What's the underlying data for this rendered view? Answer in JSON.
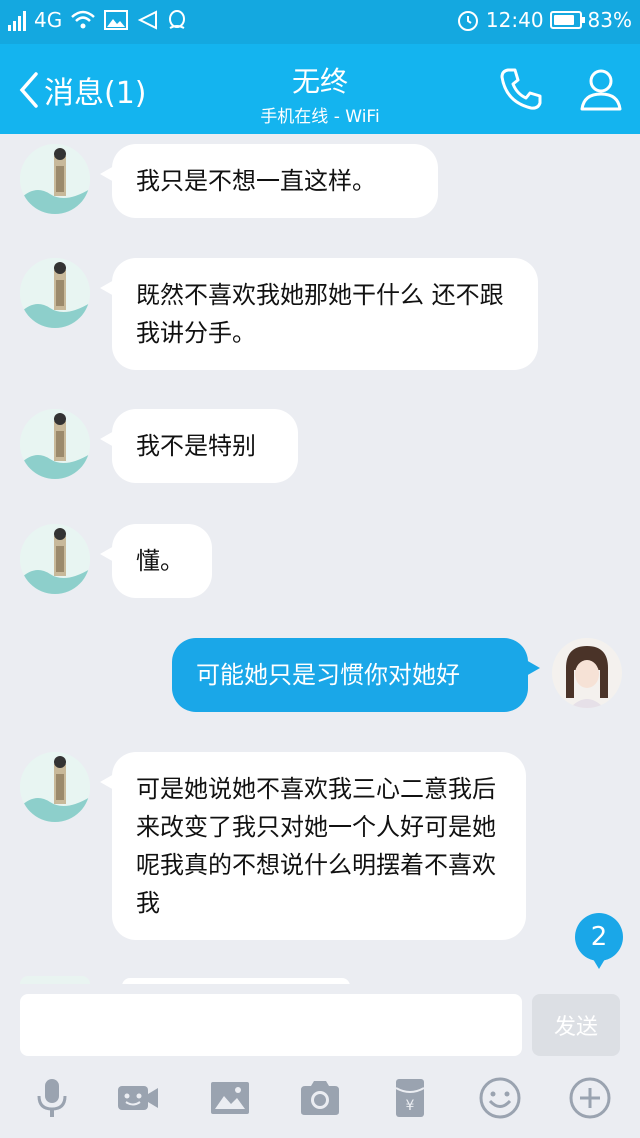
{
  "statusbar": {
    "network": "4G",
    "time": "12:40",
    "battery_pct": "83%",
    "battery_level": 0.83
  },
  "header": {
    "back_label": "消息(1)",
    "title": "无终",
    "subtitle": "手机在线 - WiFi"
  },
  "messages": [
    {
      "side": "in",
      "text": "我只是不想一直这样。"
    },
    {
      "side": "in",
      "text": "既然不喜欢我她那她干什么 还不跟我讲分手。"
    },
    {
      "side": "in",
      "text": "我不是特别"
    },
    {
      "side": "in",
      "text": "懂。"
    },
    {
      "side": "out",
      "text": "可能她只是习惯你对她好"
    },
    {
      "side": "in",
      "text": "可是她说她不喜欢我三心二意我后来改变了我只对她一个人好可是她呢我真的不想说什么明摆着不喜欢我"
    }
  ],
  "new_message_badge": "2",
  "input": {
    "placeholder": "",
    "send_label": "发送"
  },
  "icons": {
    "back": "chevron-left-icon",
    "call": "phone-icon",
    "profile": "person-icon",
    "toolbar": [
      "microphone-icon",
      "video-icon",
      "image-icon",
      "camera-icon",
      "red-packet-icon",
      "emoji-icon",
      "plus-icon"
    ]
  },
  "colors": {
    "header": "#14b4ef",
    "outgoing_bubble": "#1aa7e8",
    "incoming_bubble": "#ffffff",
    "background": "#ebedf2"
  }
}
